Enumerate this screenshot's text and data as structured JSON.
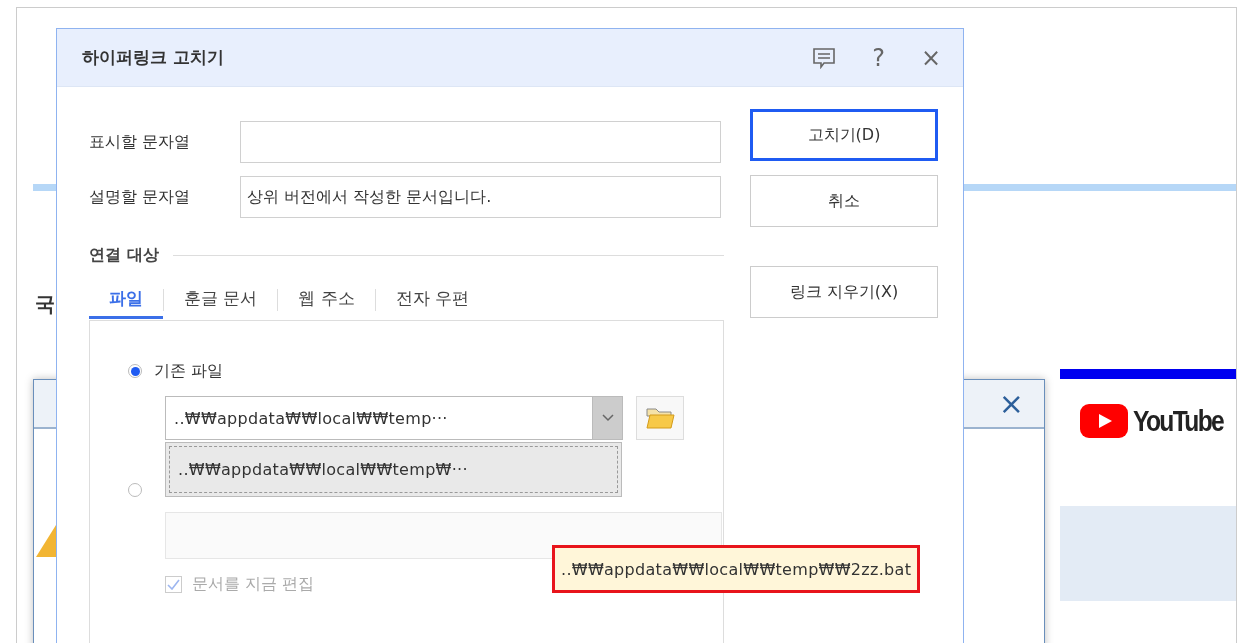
{
  "background": {
    "fragment": "국",
    "side_window": {
      "close": "×"
    },
    "logo": "YouTube"
  },
  "dialog": {
    "title": "하이퍼링크 고치기",
    "help": "?",
    "close": "×",
    "fields": [
      {
        "label": "표시할 문자열"
      },
      {
        "label": "설명할 문자열",
        "value": "상위 버전에서 작성한 문서입니다."
      }
    ],
    "buttons": [
      {
        "label": "고치기(D)",
        "default": true
      },
      {
        "label": "취소",
        "default": false
      },
      {
        "label": "링크 지우기(X)",
        "default": false
      }
    ],
    "section": "연결 대상",
    "tabs": [
      {
        "label": "파일",
        "selected": true
      },
      {
        "label": "훈글 문서",
        "selected": false
      },
      {
        "label": "웹 주소",
        "selected": false
      },
      {
        "label": "전자 우편",
        "selected": false
      }
    ],
    "existing_file": {
      "label": "기존 파일",
      "selected": true
    },
    "combo": {
      "value": "..₩₩appdata₩₩local₩₩temp···",
      "list_item": "..₩₩appdata₩₩local₩₩temp₩···"
    },
    "new_file": {
      "selected": false
    },
    "edit_now": {
      "label": "문서를 지금 편집",
      "checked": true,
      "disabled": true
    }
  },
  "tooltip": "..₩₩appdata₩₩local₩₩temp₩₩2zz.bat"
}
